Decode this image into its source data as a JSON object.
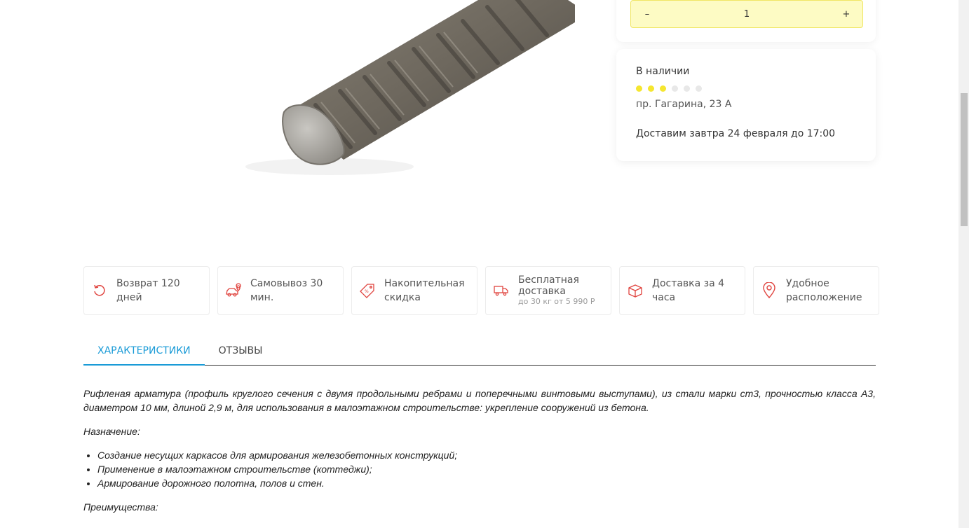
{
  "quantity": {
    "minus": "–",
    "value": "1",
    "plus": "+"
  },
  "availability": {
    "title": "В наличии",
    "stock_level": 3,
    "stock_max": 6,
    "address": "пр. Гагарина, 23 А",
    "delivery": "Доставим завтра 24 февраля до 17:00",
    "dot_colors": {
      "on": "#f5e630",
      "off": "#e8e8e8"
    }
  },
  "features": [
    {
      "icon": "return-icon",
      "text": "Возврат 120 дней"
    },
    {
      "icon": "car-pickup-icon",
      "text": "Самовывоз 30 мин."
    },
    {
      "icon": "discount-tag-icon",
      "text": "Накопительная скидка"
    },
    {
      "icon": "delivery-truck-icon",
      "text": "Бесплатная доставка",
      "sub": "до 30 кг от 5 990 Р"
    },
    {
      "icon": "package-icon",
      "text": "Доставка за 4 часа"
    },
    {
      "icon": "location-pin-icon",
      "text": "Удобное расположение"
    }
  ],
  "tabs": [
    {
      "label": "ХАРАКТЕРИСТИКИ",
      "active": true
    },
    {
      "label": "ОТЗЫВЫ",
      "active": false
    }
  ],
  "description": {
    "intro": "Рифленая арматура (профиль круглого сечения с двумя продольными ребрами и поперечными винтовыми выступами), из стали марки ст3, прочностью класса А3, диаметром 10 мм, длиной 2,9 м, для использования в малоэтажном строительстве: укрепление сооружений из бетона.",
    "purpose_heading": "Назначение:",
    "purpose_items": [
      "Создание несущих каркасов для армирования железобетонных конструкций;",
      "Применение в малоэтажном строительстве (коттеджи);",
      "Армирование дорожного полотна, полов и стен."
    ],
    "advantages_heading": "Преимущества:"
  },
  "colors": {
    "accent": "#1a9bd7",
    "icon_red": "#e0443f",
    "qty_bg": "#fdfbc4"
  }
}
